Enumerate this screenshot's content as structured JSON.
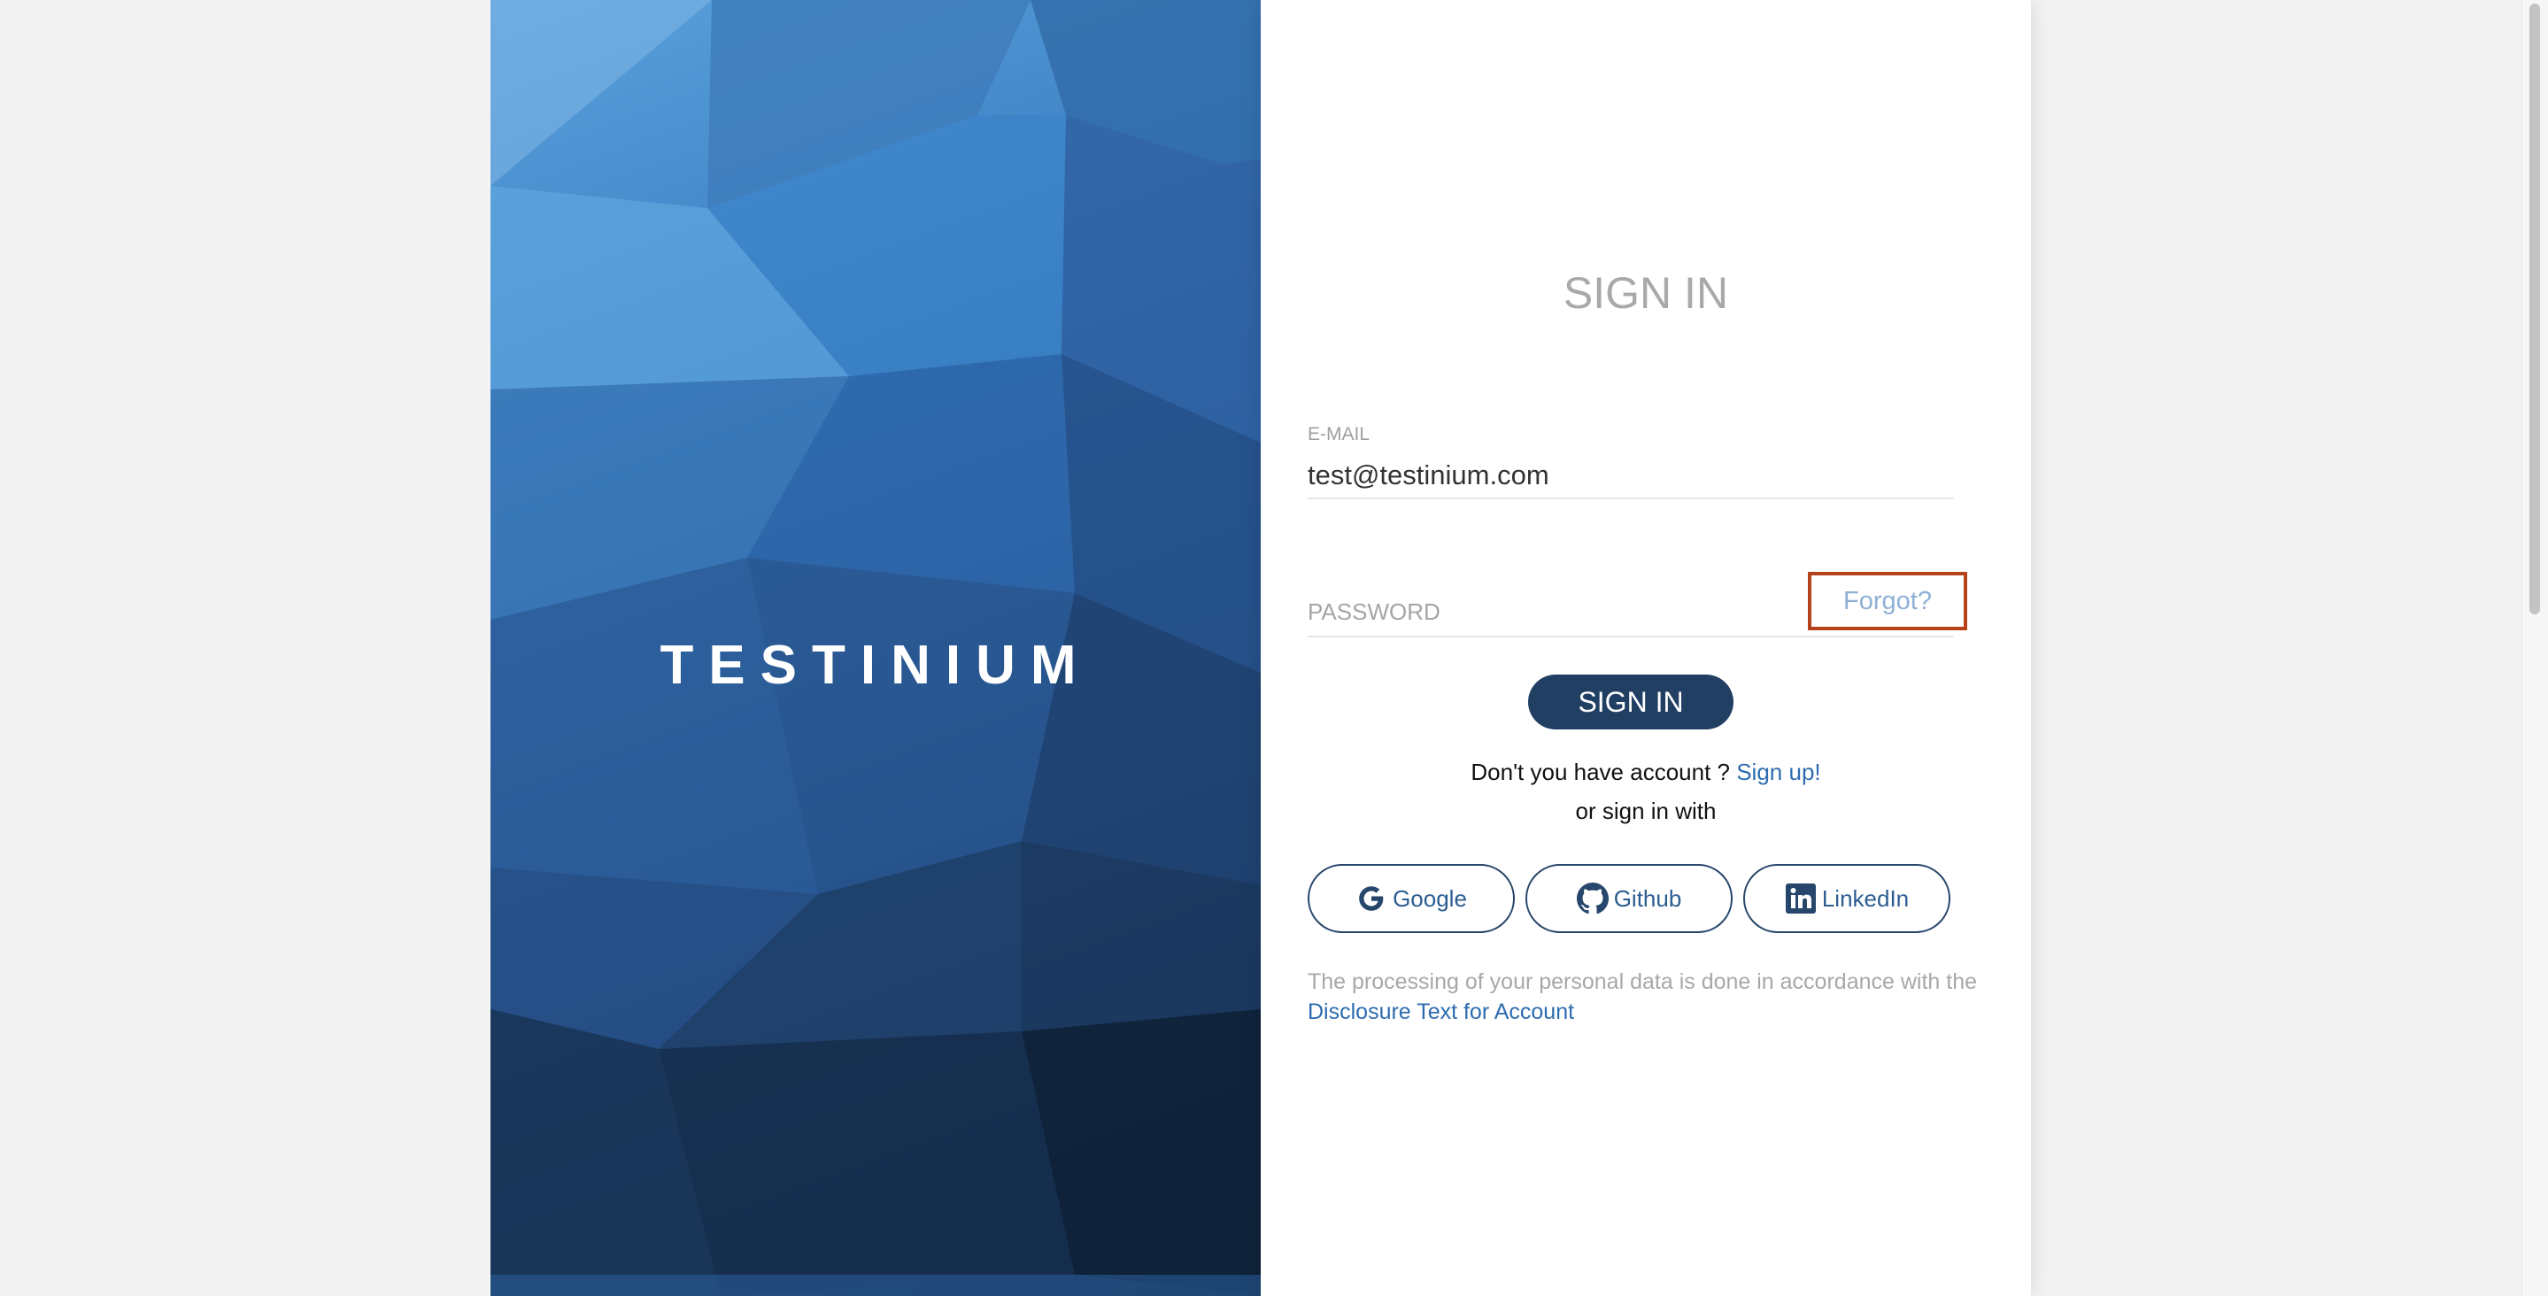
{
  "brand": {
    "title": "TESTINIUM"
  },
  "form": {
    "title": "SIGN IN",
    "email_label": "E-MAIL",
    "email_value": "test@testinium.com",
    "password_placeholder": "PASSWORD",
    "forgot_label": "Forgot?",
    "signin_label": "SIGN IN",
    "signup_prompt": "Don't you have account ?",
    "signup_link": "Sign up!",
    "or_text": "or sign in with"
  },
  "social": {
    "google_label": "Google",
    "github_label": "Github",
    "linkedin_label": "LinkedIn"
  },
  "disclaimer": {
    "text": "The processing of your personal data is done in accordance with the",
    "link": "Disclosure Text for Account"
  },
  "colors": {
    "primary": "#203f63",
    "link": "#2d6cb0",
    "highlight_border": "#b5421a"
  },
  "icons": {
    "google": "google-icon",
    "github": "github-icon",
    "linkedin": "linkedin-icon"
  }
}
